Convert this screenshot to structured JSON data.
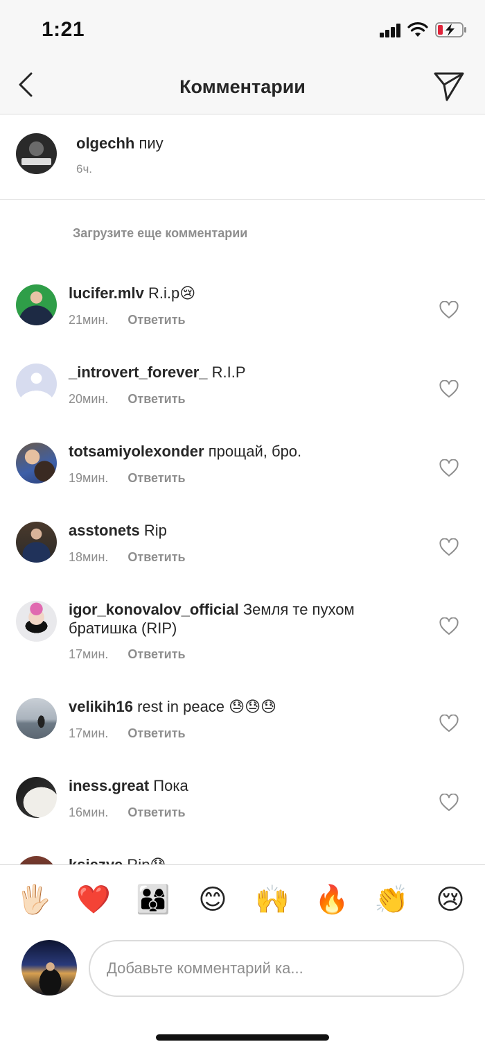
{
  "status_bar": {
    "time": "1:21"
  },
  "header": {
    "title": "Комментарии"
  },
  "caption": {
    "username": "olgechh",
    "text": "пиу",
    "time": "6ч."
  },
  "load_more_label": "Загрузите еще комментарии",
  "comments": [
    {
      "username": "lucifer.mlv",
      "text": "R.i.p😢",
      "time": "21мин.",
      "reply": "Ответить"
    },
    {
      "username": "_introvert_forever_",
      "text": "R.I.P",
      "time": "20мин.",
      "reply": "Ответить"
    },
    {
      "username": "totsamiyolexonder",
      "text": "прощай, бро.",
      "time": "19мин.",
      "reply": "Ответить"
    },
    {
      "username": "asstonets",
      "text": "Rip",
      "time": "18мин.",
      "reply": "Ответить"
    },
    {
      "username": "igor_konovalov_official",
      "text": "Земля те пухом братишка (RIP)",
      "time": "17мин.",
      "reply": "Ответить"
    },
    {
      "username": "velikih16",
      "text": "rest in peace 😓😓😓",
      "time": "17мин.",
      "reply": "Ответить"
    },
    {
      "username": "iness.great",
      "text": "Пока",
      "time": "16мин.",
      "reply": "Ответить"
    },
    {
      "username": "ksiezye",
      "text": "Rip😓",
      "time": "",
      "reply": ""
    }
  ],
  "emoji_bar": [
    "🖐🏻",
    "❤️",
    "👨‍👩‍👦",
    "😊",
    "🙌",
    "🔥",
    "👏",
    "😢"
  ],
  "composer": {
    "placeholder": "Добавьте комментарий ка..."
  },
  "icons": {
    "back": "chevron-left-icon",
    "send": "paper-plane-icon",
    "like": "heart-outline-icon"
  },
  "colors": {
    "text_primary": "#262626",
    "text_secondary": "#8e8e8e",
    "divider": "#dbdbdb",
    "battery_low": "#e0243a"
  }
}
